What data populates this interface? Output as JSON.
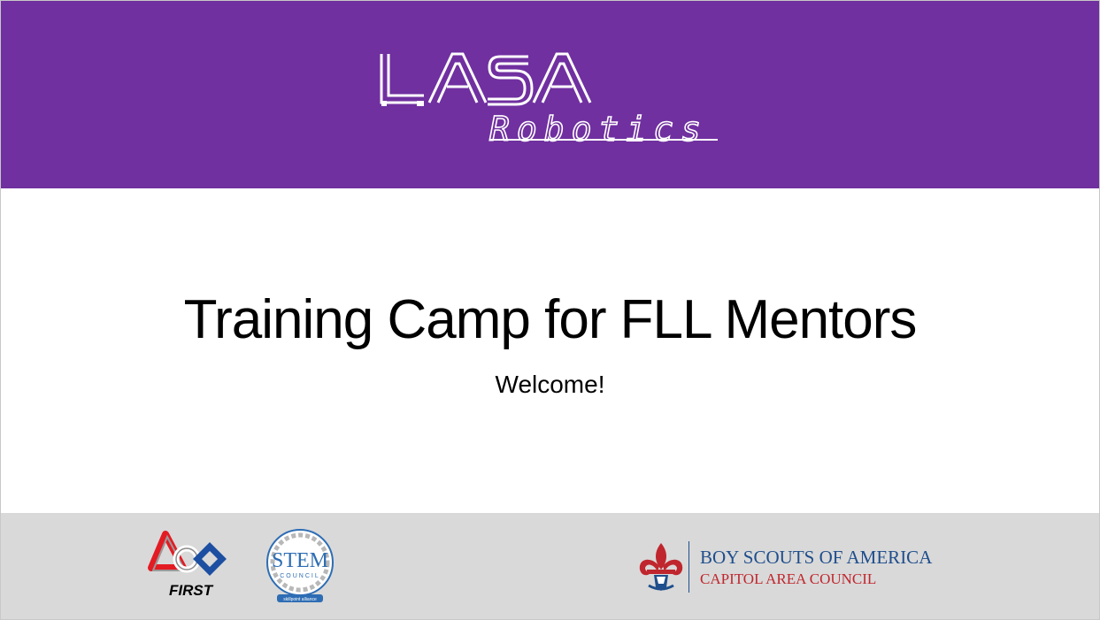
{
  "header": {
    "logo_word_1": "LASA",
    "logo_word_2": "Robotics",
    "background_color": "#7030a0"
  },
  "main": {
    "title": "Training Camp for FLL Mentors",
    "subtitle": "Welcome!"
  },
  "footer": {
    "background_color": "#d9d9d9",
    "first_logo": {
      "word": "FIRST",
      "icon": "first-logo-icon"
    },
    "stem_logo": {
      "main": "STEM",
      "sub": "COUNCIL",
      "tagline": "skillpoint alliance",
      "icon": "stem-council-logo-icon"
    },
    "bsa_logo": {
      "line1": "BOY SCOUTS OF AMERICA",
      "line2": "CAPITOL AREA COUNCIL",
      "icon": "fleur-de-lis-icon",
      "blue": "#1f4e8c",
      "red": "#c0262d"
    }
  }
}
